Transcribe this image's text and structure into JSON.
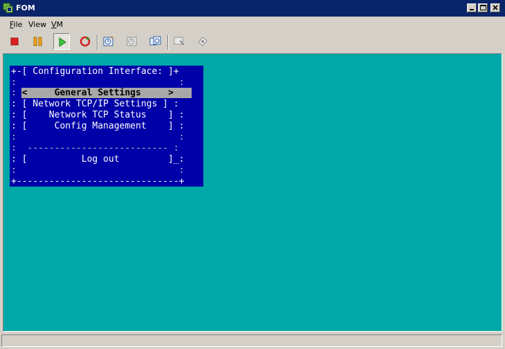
{
  "window": {
    "title": "FOM",
    "accent": "#0a246a",
    "controls": [
      "minimize-icon",
      "maximize-icon",
      "close-icon"
    ]
  },
  "menu": {
    "items": [
      {
        "mnemonic": "F",
        "rest": "ile"
      },
      {
        "mnemonic": "",
        "rest": "View"
      },
      {
        "mnemonic": "V",
        "rest": "M"
      }
    ]
  },
  "toolbar": {
    "buttons": [
      "stop-icon",
      "pause-icon",
      "play-icon",
      "reset-icon",
      "snapshot-icon",
      "revert-snapshot-icon",
      "snapshot-manager-icon",
      "full-screen-icon",
      "unity-icon"
    ],
    "pressed": "play-icon"
  },
  "console": {
    "background": "#00a8a8",
    "panel_background": "#0000a8",
    "lines": {
      "top": "+-[ Configuration Interface: ]+",
      "blank1": ":                              :",
      "sel_border": ":                              :",
      "general": "General Settings",
      "network_tcpip": ": [ Network TCP/IP Settings ] :",
      "network_status": ": [    Network TCP Status    ] :",
      "config_mgmt": ": [     Config Management    ] :",
      "blank2": ":                              :",
      "divider": ":  -------------------------- :",
      "logout": ": [          Log out         ]_:",
      "blank3": ":                              :",
      "bottom": "+------------------------------+"
    },
    "selected_text": "  <     General Settings     >"
  },
  "statusbar": {
    "text": ""
  }
}
